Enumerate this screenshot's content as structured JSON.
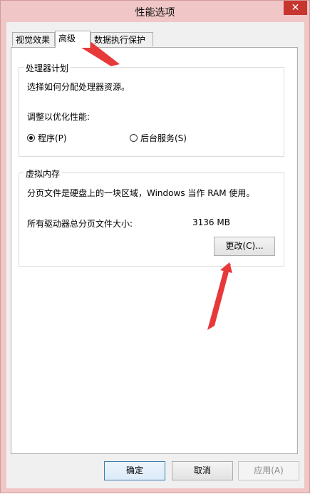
{
  "window": {
    "title": "性能选项"
  },
  "tabs": [
    {
      "label": "视觉效果"
    },
    {
      "label": "高级"
    },
    {
      "label": "数据执行保护"
    }
  ],
  "processor": {
    "legend": "处理器计划",
    "description": "选择如何分配处理器资源。",
    "adjust_label": "调整以优化性能:",
    "options": [
      {
        "label": "程序(P)",
        "checked": true
      },
      {
        "label": "后台服务(S)",
        "checked": false
      }
    ]
  },
  "virtual_memory": {
    "legend": "虚拟内存",
    "description": "分页文件是硬盘上的一块区域，Windows 当作 RAM 使用。",
    "total_label": "所有驱动器总分页文件大小:",
    "total_value": "3136 MB",
    "change_button": "更改(C)..."
  },
  "footer": {
    "ok": "确定",
    "cancel": "取消",
    "apply": "应用(A)"
  },
  "colors": {
    "annotation_arrow": "#e8393a",
    "title_bar": "#f0c6c6",
    "close_button": "#c7352f"
  }
}
